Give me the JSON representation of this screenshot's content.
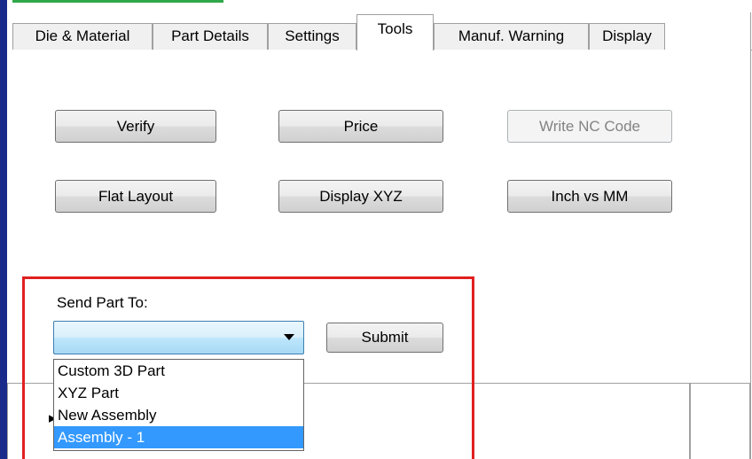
{
  "tabs": [
    {
      "label": "Die & Material",
      "active": false
    },
    {
      "label": "Part Details",
      "active": false
    },
    {
      "label": "Settings",
      "active": false
    },
    {
      "label": "Tools",
      "active": true
    },
    {
      "label": "Manuf. Warning",
      "active": false
    },
    {
      "label": "Display",
      "active": false
    }
  ],
  "tools": {
    "verify_label": "Verify",
    "price_label": "Price",
    "write_nc_label": "Write NC Code",
    "write_nc_enabled": false,
    "flat_layout_label": "Flat Layout",
    "display_xyz_label": "Display XYZ",
    "inch_vs_mm_label": "Inch vs MM"
  },
  "send_part": {
    "label": "Send Part To:",
    "selected_value": "",
    "submit_label": "Submit",
    "options": [
      "Custom 3D Part",
      "XYZ Part",
      "New Assembly",
      "Assembly - 1"
    ],
    "highlighted_option": "Assembly - 1"
  },
  "colors": {
    "highlight_border": "#e02020",
    "selection": "#3399ff",
    "window_border": "#1a2a8a"
  }
}
